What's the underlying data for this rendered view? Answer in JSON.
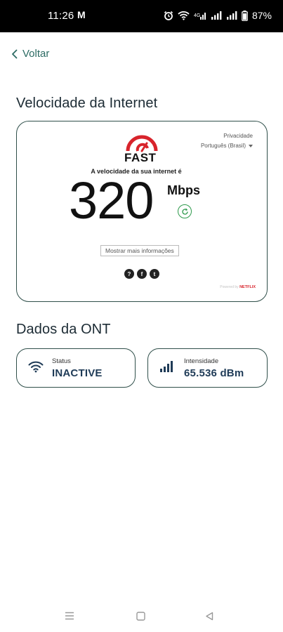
{
  "status_bar": {
    "time": "11:26",
    "carrier_icon": "M",
    "battery": "87%",
    "icons": [
      "alarm-icon",
      "wifi-icon",
      "signal-icon",
      "signal-icon",
      "battery-icon"
    ]
  },
  "header": {
    "back_label": "Voltar"
  },
  "speed_section": {
    "title": "Velocidade da Internet",
    "widget": {
      "logo_text": "FAST",
      "privacy": "Privacidade",
      "language": "Português (Brasil)",
      "caption": "A velocidade da sua internet é",
      "speed_value": "320",
      "speed_unit": "Mbps",
      "more_info": "Mostrar mais informações",
      "social": [
        "?",
        "f",
        "t"
      ],
      "powered_by": "Powered by",
      "powered_brand": "NETFLIX"
    }
  },
  "ont_section": {
    "title": "Dados da ONT",
    "status": {
      "label": "Status",
      "value": "INACTIVE",
      "icon": "wifi-icon"
    },
    "intensity": {
      "label": "Intensidade",
      "value": "65.536 dBm",
      "icon": "signal-bars-icon"
    }
  },
  "colors": {
    "accent": "#2c6b63",
    "card_border": "#2f4f4a",
    "value_text": "#1f3b57",
    "fast_red": "#d8242c",
    "refresh_green": "#2e9a4c"
  }
}
